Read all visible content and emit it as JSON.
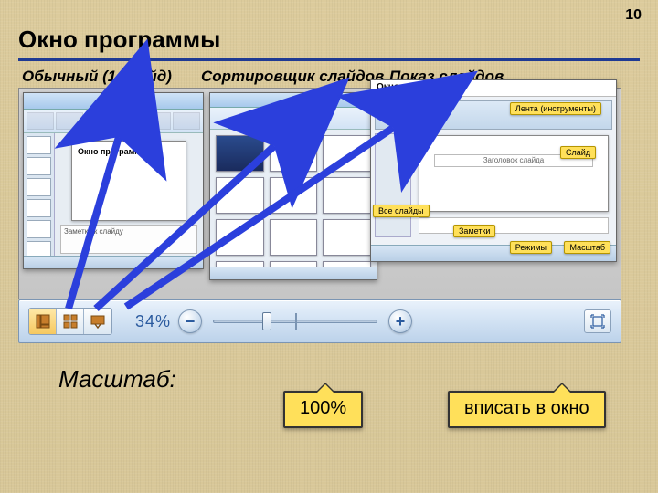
{
  "page_number": "10",
  "title": "Окно программы",
  "view_labels": {
    "normal": "Обычный (1 слайд)",
    "sorter": "Сортировщик слайдов",
    "show": "Показ слайдов"
  },
  "shot1": {
    "slide_title": "Окно программы",
    "notes_placeholder": "Заметки к слайду"
  },
  "shot3": {
    "header": "Окно программы",
    "slide_placeholder": "Заголовок слайда",
    "callouts": {
      "ribbon": "Лента (инструменты)",
      "all_slides": "Все слайды",
      "slide": "Слайд",
      "notes": "Заметки",
      "modes": "Режимы",
      "zoom": "Масштаб"
    }
  },
  "statusbar": {
    "zoom_pct": "34%"
  },
  "scale_label": "Масштаб:",
  "callout_100": "100%",
  "callout_fit": "вписать в окно"
}
